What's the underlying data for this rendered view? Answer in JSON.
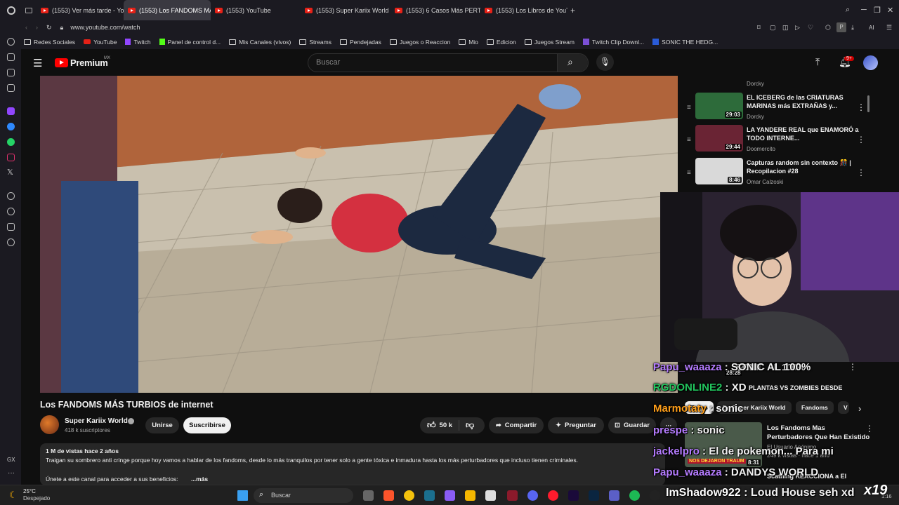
{
  "browser": {
    "tabs": [
      {
        "label": "(1553) Ver más tarde - You"
      },
      {
        "label": "(1553) Los FANDOMS MÁ"
      },
      {
        "label": "(1553) YouTube"
      },
      {
        "label": "(1553) Super Kariix World"
      },
      {
        "label": "(1553) 6 Casos Más PERT"
      },
      {
        "label": "(1553) Los Libros de YouTu"
      }
    ],
    "url": "www.youtube.com/watch",
    "ai_label": "AI",
    "profile_letter": "P",
    "gx_label": "GX",
    "bookmarks": [
      "Redes Sociales",
      "YouTube",
      "Twitch",
      "Panel de control d...",
      "Mis Canales (vivos)",
      "Streams",
      "Pendejadas",
      "Juegos o Reaccion",
      "Mio",
      "Edicion",
      "Juegos Stream",
      "Twitch Clip Downl...",
      "SONIC THE HEDG..."
    ]
  },
  "youtube": {
    "logo": "Premium",
    "region": "MX",
    "search_placeholder": "Buscar",
    "notif_count": "9+",
    "video_title": "Los FANDOMS MÁS TURBIOS de internet",
    "channel_name": "Super Kariix World",
    "subscribers": "418 k suscriptores",
    "join_label": "Unirse",
    "subscribe_label": "Suscribirse",
    "likes": "50 k",
    "share_label": "Compartir",
    "ask_label": "Preguntar",
    "save_label": "Guardar",
    "more_label": "···",
    "views_date": "1 M de vistas  hace 2 años",
    "description": "Traigan su sombrero anti cringe porque hoy vamos a hablar de los fandoms, desde lo más tranquilos por  tener solo a gente tóxica e inmadura hasta los más perturbadores que incluso tienen criminales.",
    "description2": "Únete a este canal para acceder a sus beneficios:",
    "more_text": "...más"
  },
  "rail": {
    "items": [
      {
        "title": "EL ICEBERG de las CRIATURAS MARINAS más EXTRAÑAS y...",
        "channel": "Dorcky",
        "duration": "29:03",
        "color": "#2d6b3a"
      },
      {
        "title": "LA YANDERE REAL que ENAMORÓ a TODO INTERNE...",
        "channel": "Doomercito",
        "duration": "29:44",
        "color": "#6a2434"
      },
      {
        "title": "Capturas random sin contexto 🎊 | Recopilacion #28",
        "channel": "Omar Calzoski",
        "duration": "8:46",
        "color": "#d9d9d9"
      }
    ],
    "top_channel": "Dorcky",
    "partial_duration": "28:28",
    "partial_title": "SONIC AL 100%",
    "partial_title2": "PLANTAS VS ZOMBIES DESDE",
    "chips": [
      "Todos",
      "De Super Kariix World",
      "Fandoms",
      "V"
    ],
    "card_title": "Los Fandoms Mas Perturbadores Que Han Existido",
    "card_channel": "El Usuario Anónimo",
    "card_thumb_text": "NOS DEJARON TRAUM",
    "card_duration": "8:31",
    "card_views": "249 k vistas · hace 1 año",
    "card_partial": "Scathing REACCIONA a El"
  },
  "chat": [
    {
      "user": "Papu_waaaza",
      "msg": "SONIC AL 100%",
      "color": "#b57cff"
    },
    {
      "user": "RGDONLINE2",
      "msg": "XD",
      "color": "#22c55e"
    },
    {
      "user": "Marmotaty",
      "msg": "sonic",
      "color": "#ff9f1a"
    },
    {
      "user": "prespe",
      "msg": "sonic",
      "color": "#b57cff"
    },
    {
      "user": "jackelpro",
      "msg": "El de pokemon... Para mi",
      "color": "#b57cff"
    },
    {
      "user": "Papu_waaaza",
      "msg": "DANDYS WORLD",
      "color": "#b57cff"
    },
    {
      "user": "ImShadow922",
      "msg": "Loud House seh xd",
      "color": "#ffffff"
    }
  ],
  "overlay_counter": "x19",
  "taskbar": {
    "temp": "25°C",
    "weather": "Despejado",
    "search": "Buscar",
    "clock": "1:16"
  }
}
